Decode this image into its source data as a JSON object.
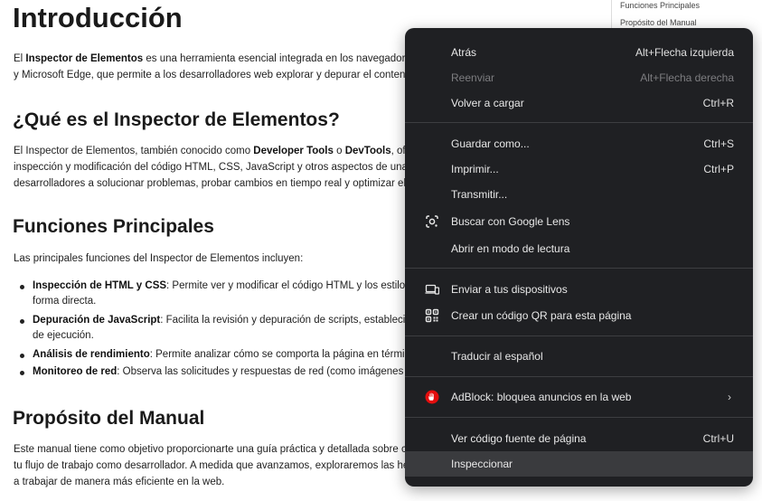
{
  "toc": {
    "items": [
      "Funciones Principales",
      "Propósito del Manual"
    ]
  },
  "article": {
    "title": "Introducción",
    "intro": {
      "l1_pre": "El ",
      "l1_bold": "Inspector de Elementos",
      "l1_post": " es una herramienta esencial integrada en los navegadores mode",
      "l2": "y Microsoft Edge, que permite a los desarrolladores web explorar y depurar el contenido de"
    },
    "h2_what": "¿Qué es el Inspector de Elementos?",
    "what": {
      "l1_a": "El Inspector de Elementos, también conocido como ",
      "l1_b": "Developer Tools",
      "l1_c": " o ",
      "l1_d": "DevTools",
      "l1_e": ", ofrece un",
      "l2": "inspección y modificación del código HTML, CSS, JavaScript y otros aspectos de una página",
      "l3": "desarrolladores a solucionar problemas, probar cambios en tiempo real y optimizar el rendir"
    },
    "h2_funcs": "Funciones Principales",
    "funcs_intro": "Las principales funciones del Inspector de Elementos incluyen:",
    "bullets": [
      {
        "bold": "Inspección de HTML y CSS",
        "text": ": Permite ver y modificar el código HTML y los estilos CSS ap",
        "cont": "forma directa."
      },
      {
        "bold": "Depuración de JavaScript",
        "text": ": Facilita la revisión y depuración de scripts, estableciendo pu",
        "cont": "de ejecución."
      },
      {
        "bold": "Análisis de rendimiento",
        "text": ": Permite analizar cómo se comporta la página en términos de",
        "cont": ""
      },
      {
        "bold": "Monitoreo de red",
        "text": ": Observa las solicitudes y respuestas de red (como imágenes y datos",
        "cont": ""
      }
    ],
    "h2_purpose": "Propósito del Manual",
    "purpose": {
      "l1": "Este manual tiene como objetivo proporcionarte una guía práctica y detallada sobre cómo u",
      "l2": "tu flujo de trabajo como desarrollador. A medida que avanzamos, exploraremos las herramie",
      "l3": "a trabajar de manera más eficiente en la web."
    }
  },
  "context_menu": {
    "back": {
      "label": "Atrás",
      "shortcut": "Alt+Flecha izquierda"
    },
    "forward": {
      "label": "Reenviar",
      "shortcut": "Alt+Flecha derecha"
    },
    "reload": {
      "label": "Volver a cargar",
      "shortcut": "Ctrl+R"
    },
    "save_as": {
      "label": "Guardar como...",
      "shortcut": "Ctrl+S"
    },
    "print": {
      "label": "Imprimir...",
      "shortcut": "Ctrl+P"
    },
    "cast": {
      "label": "Transmitir..."
    },
    "lens": {
      "label": "Buscar con Google Lens",
      "icon": "google-lens-icon"
    },
    "reader": {
      "label": "Abrir en modo de lectura"
    },
    "send_devices": {
      "label": "Enviar a tus dispositivos",
      "icon": "devices-icon"
    },
    "qr": {
      "label": "Crear un código QR para esta página",
      "icon": "qr-code-icon"
    },
    "translate": {
      "label": "Traducir al español"
    },
    "adblock": {
      "label": "AdBlock: bloquea anuncios en la web",
      "icon": "adblock-hand-icon",
      "icon_color": "#e40d0d"
    },
    "view_source": {
      "label": "Ver código fuente de página",
      "shortcut": "Ctrl+U"
    },
    "inspect": {
      "label": "Inspeccionar"
    }
  }
}
